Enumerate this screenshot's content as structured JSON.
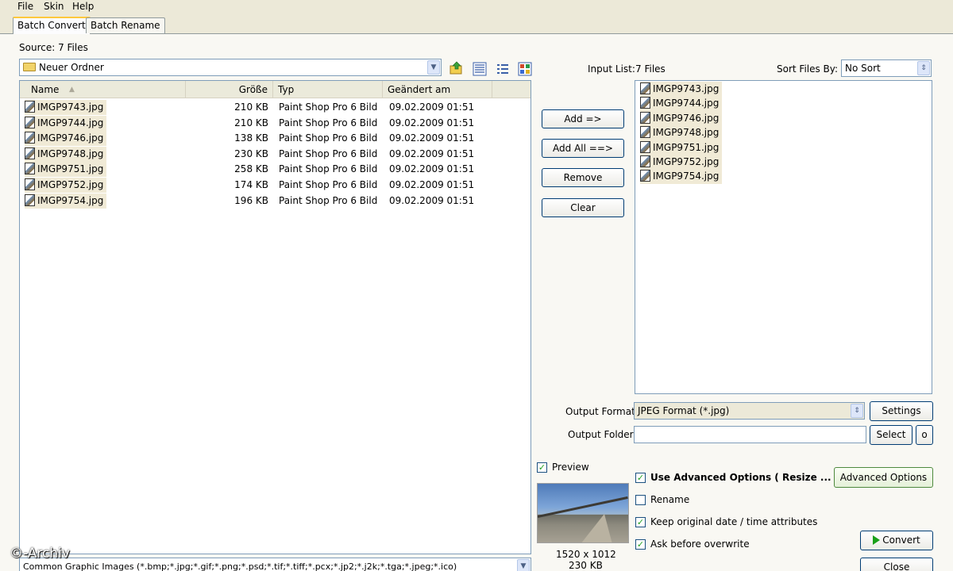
{
  "menu": [
    "File",
    "Skin",
    "Help"
  ],
  "tabs": [
    "Batch Convert",
    "Batch Rename"
  ],
  "source": {
    "label": "Source: 7 Files",
    "folder": "Neuer Ordner",
    "columns": [
      "Name",
      "Größe",
      "Typ",
      "Geändert am"
    ],
    "files": [
      {
        "name": "IMGP9743.jpg",
        "size": "210 KB",
        "type": "Paint Shop Pro 6 Bild",
        "modified": "09.02.2009 01:51"
      },
      {
        "name": "IMGP9744.jpg",
        "size": "210 KB",
        "type": "Paint Shop Pro 6 Bild",
        "modified": "09.02.2009 01:51"
      },
      {
        "name": "IMGP9746.jpg",
        "size": "138 KB",
        "type": "Paint Shop Pro 6 Bild",
        "modified": "09.02.2009 01:51"
      },
      {
        "name": "IMGP9748.jpg",
        "size": "230 KB",
        "type": "Paint Shop Pro 6 Bild",
        "modified": "09.02.2009 01:51"
      },
      {
        "name": "IMGP9751.jpg",
        "size": "258 KB",
        "type": "Paint Shop Pro 6 Bild",
        "modified": "09.02.2009 01:51"
      },
      {
        "name": "IMGP9752.jpg",
        "size": "174 KB",
        "type": "Paint Shop Pro 6 Bild",
        "modified": "09.02.2009 01:51"
      },
      {
        "name": "IMGP9754.jpg",
        "size": "196 KB",
        "type": "Paint Shop Pro 6 Bild",
        "modified": "09.02.2009 01:51"
      }
    ],
    "filter": "Common Graphic Images (*.bmp;*.jpg;*.gif;*.png;*.psd;*.tif;*.tiff;*.pcx;*.jp2;*.j2k;*.tga;*.jpeg;*.ico)"
  },
  "buttons": {
    "add": "Add =>",
    "add_all": "Add All ==>",
    "remove": "Remove",
    "clear": "Clear",
    "settings": "Settings",
    "select": "Select",
    "open": "o",
    "advanced_options": "Advanced Options",
    "convert": "Convert",
    "close": "Close"
  },
  "input_list": {
    "label": "Input List:",
    "count": "7 Files",
    "sort_label": "Sort Files By:",
    "sort_value": "No Sort",
    "files": [
      "IMGP9743.jpg",
      "IMGP9744.jpg",
      "IMGP9746.jpg",
      "IMGP9748.jpg",
      "IMGP9751.jpg",
      "IMGP9752.jpg",
      "IMGP9754.jpg"
    ]
  },
  "output": {
    "format_label": "Output Format:",
    "format_value": "JPEG Format (*.jpg)",
    "folder_label": "Output Folder:",
    "folder_value": ""
  },
  "preview": {
    "label": "Preview",
    "checked": true,
    "dimensions": "1520 x 1012",
    "size": "230 KB"
  },
  "options": {
    "use_advanced": {
      "label": "Use Advanced Options ( Resize ... )",
      "checked": true
    },
    "rename": {
      "label": "Rename",
      "checked": false
    },
    "keep_date": {
      "label": "Keep original date / time attributes",
      "checked": true
    },
    "ask_overwrite": {
      "label": "Ask before overwrite",
      "checked": true
    }
  },
  "watermark": "©-Archiv",
  "icons": {
    "folder": "folder-icon",
    "up": "folder-up-icon",
    "views": [
      "list-view-icon",
      "details-view-icon",
      "thumbnail-view-icon"
    ],
    "convert": "play-icon"
  }
}
